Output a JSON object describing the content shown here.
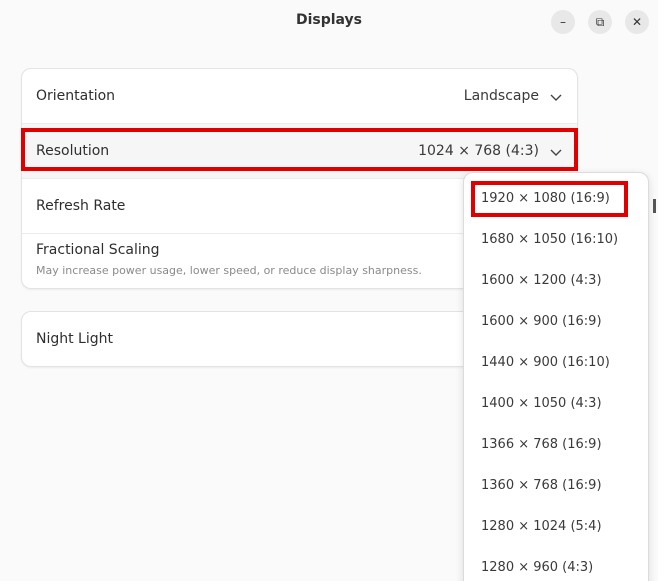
{
  "window": {
    "title": "Displays",
    "buttons": {
      "minimize": "–",
      "maximize": "⧉",
      "close": "✕"
    }
  },
  "settings": {
    "orientation": {
      "label": "Orientation",
      "value": "Landscape"
    },
    "resolution": {
      "label": "Resolution",
      "value": "1024 × 768 (4:3)"
    },
    "refresh_rate": {
      "label": "Refresh Rate"
    },
    "fractional_scaling": {
      "label": "Fractional Scaling",
      "description": "May increase power usage, lower speed, or reduce display sharpness."
    }
  },
  "night_light": {
    "label": "Night Light"
  },
  "resolution_menu": {
    "options": [
      "1920 × 1080 (16:9)",
      "1680 × 1050 (16:10)",
      "1600 × 1200 (4:3)",
      "1600 × 900 (16:9)",
      "1440 × 900 (16:10)",
      "1400 × 1050 (4:3)",
      "1366 × 768 (16:9)",
      "1360 × 768 (16:9)",
      "1280 × 1024 (5:4)",
      "1280 × 960 (4:3)"
    ]
  },
  "colors": {
    "highlight": "#e10000",
    "background": "#fafafa",
    "card": "#ffffff"
  },
  "icons": {
    "chevron": "chevron-down-icon"
  }
}
